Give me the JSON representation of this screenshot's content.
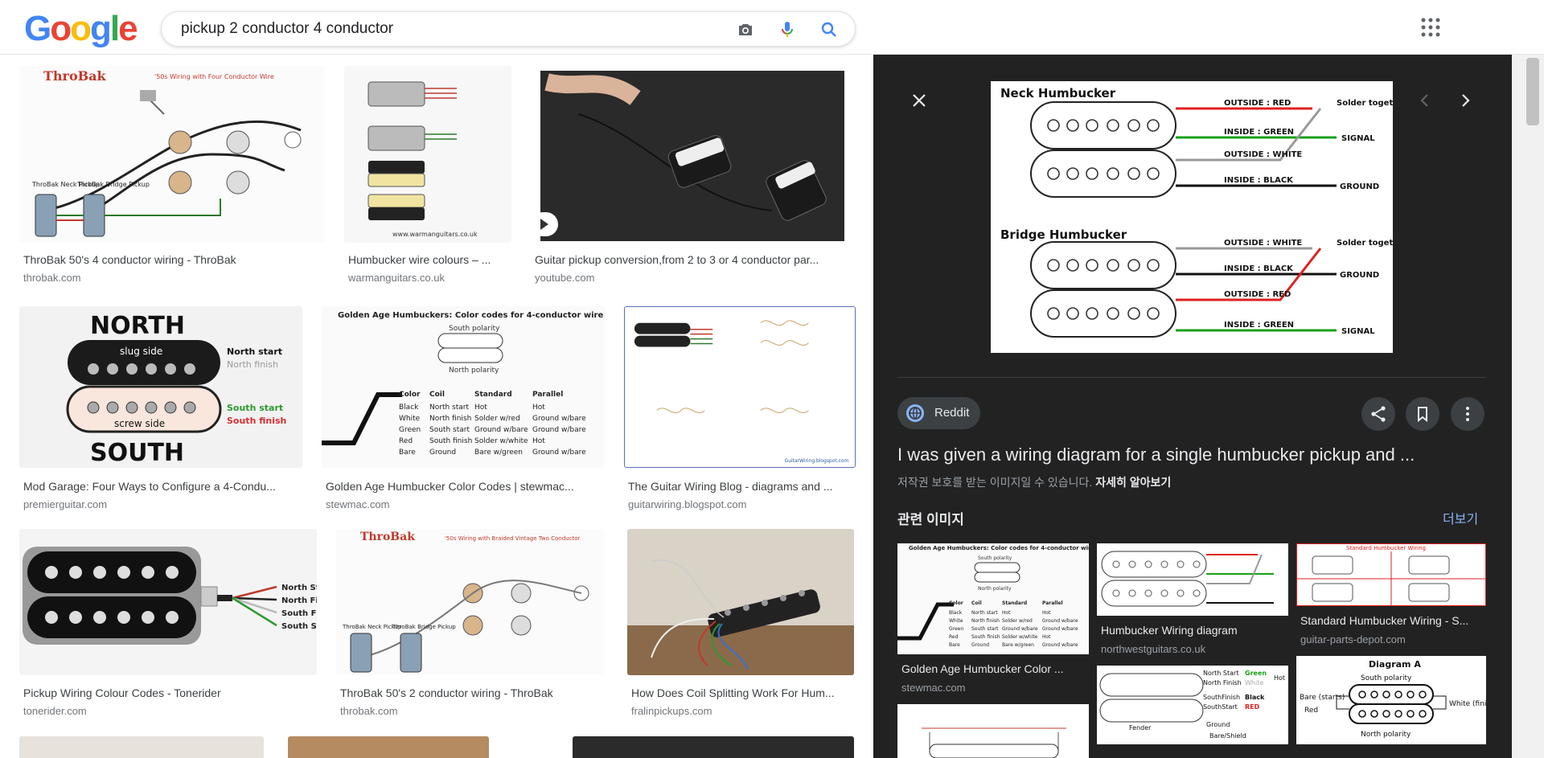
{
  "header": {
    "logo": {
      "letters": [
        "G",
        "o",
        "o",
        "g",
        "l",
        "e"
      ],
      "colors": [
        "#4285F4",
        "#EA4335",
        "#FBBC05",
        "#4285F4",
        "#34A853",
        "#EA4335"
      ]
    },
    "search": {
      "query": "pickup 2 conductor 4 conductor"
    },
    "icons": [
      "camera-icon",
      "microphone-icon",
      "search-icon",
      "apps-icon"
    ]
  },
  "results": [
    {
      "title": "ThroBak 50's 4 conductor wiring - ThroBak",
      "source": "throbak.com"
    },
    {
      "title": "Humbucker wire colours – ...",
      "source": "warmanguitars.co.uk"
    },
    {
      "title": "Guitar pickup conversion,from 2 to 3 or 4 conductor par...",
      "source": "youtube.com"
    },
    {
      "title": "Mod Garage: Four Ways to Configure a 4-Condu...",
      "source": "premierguitar.com"
    },
    {
      "title": "Golden Age Humbucker Color Codes | stewmac...",
      "source": "stewmac.com"
    },
    {
      "title": "The Guitar Wiring Blog - diagrams and ...",
      "source": "guitarwiring.blogspot.com"
    },
    {
      "title": "Pickup Wiring Colour Codes - Tonerider",
      "source": "tonerider.com"
    },
    {
      "title": "ThroBak 50's 2 conductor wiring - ThroBak",
      "source": "throbak.com"
    },
    {
      "title": "How Does Coil Splitting Work For Hum...",
      "source": "fralinpickups.com"
    }
  ],
  "thumb_text": {
    "throbak_brand": "ThroBak",
    "throbak4_caption": "'50s Wiring with Four Conductor Wire",
    "throbak2_caption": "'50s Wiring with Braided Vintage Two Conductor",
    "neck_pickup": "ThroBak Neck Pickup",
    "bridge_pickup": "ThroBak Bridge Pickup",
    "warman_url": "www.warmanguitars.co.uk",
    "north": "NORTH",
    "slug_side": "slug side",
    "screw_side": "screw side",
    "south": "SOUTH",
    "north_start": "North start",
    "north_finish": "North finish",
    "south_start": "South start",
    "south_finish": "South finish",
    "golden_title": "Golden Age Humbuckers: Color codes for 4-conductor wire",
    "south_polarity": "South polarity",
    "north_polarity": "North polarity",
    "gw_url": "GuitarWiring.blogspot.com",
    "tr_north_start": "North Sta",
    "tr_north_finish": "North Fin",
    "tr_south_finish": "South Fin",
    "tr_south_start": "South Sta"
  },
  "golden_table": {
    "headers": [
      "Color",
      "Coil",
      "Standard",
      "Parallel"
    ],
    "rows": [
      [
        "Black",
        "North start",
        "Hot",
        "Hot"
      ],
      [
        "White",
        "North finish",
        "Solder w/red",
        "Ground w/bare"
      ],
      [
        "Green",
        "South start",
        "Ground w/bare",
        "Ground w/bare"
      ],
      [
        "Red",
        "South finish",
        "Solder w/white",
        "Hot"
      ],
      [
        "Bare",
        "Ground",
        "Bare w/green",
        "Ground w/bare"
      ]
    ]
  },
  "preview": {
    "diagram": {
      "neck_label": "Neck Humbucker",
      "bridge_label": "Bridge Humbucker",
      "neck_wires": [
        "OUTSIDE : RED",
        "INSIDE : GREEN",
        "OUTSIDE : WHITE",
        "INSIDE : BLACK"
      ],
      "bridge_wires": [
        "OUTSIDE : WHITE",
        "INSIDE : BLACK",
        "OUTSIDE : RED",
        "INSIDE : GREEN"
      ],
      "ends": [
        "Solder together",
        "SIGNAL",
        "GROUND"
      ]
    },
    "source_label": "Reddit",
    "title": "I was given a wiring diagram for a single humbucker pickup and ...",
    "copyright": "저작권 보호를 받는 이미지일 수 있습니다.",
    "learn_more": "자세히 알아보기",
    "related_heading": "관련 이미지",
    "related_more": "더보기",
    "related": [
      {
        "title": "Golden Age Humbucker Color ...",
        "source": "stewmac.com"
      },
      {
        "title": "Humbucker Wiring diagram",
        "source": "northwestguitars.co.uk"
      },
      {
        "title": "Standard Humbucker Wiring - S...",
        "source": "guitar-parts-depot.com"
      }
    ],
    "related_thumb_text": {
      "std_title": "Standard Humbucker Wiring",
      "diagram_a": "Diagram A",
      "south_polarity": "South polarity",
      "north_polarity": "North polarity",
      "bare_starts": "Bare (starts)",
      "red": "Red",
      "white_finishes": "White (finishes)",
      "hw_north_start": "North Start",
      "hw_green": "Green",
      "hw_hot": "Hot",
      "hw_north_finish": "North Finish",
      "hw_white": "White",
      "hw_south_finish": "SouthFinish",
      "hw_black": "Black",
      "hw_south_start": "SouthStart",
      "hw_red": "RED",
      "hw_fender": "Fender",
      "hw_ground": "Ground",
      "hw_bare_shield": "Bare/Shield"
    }
  }
}
